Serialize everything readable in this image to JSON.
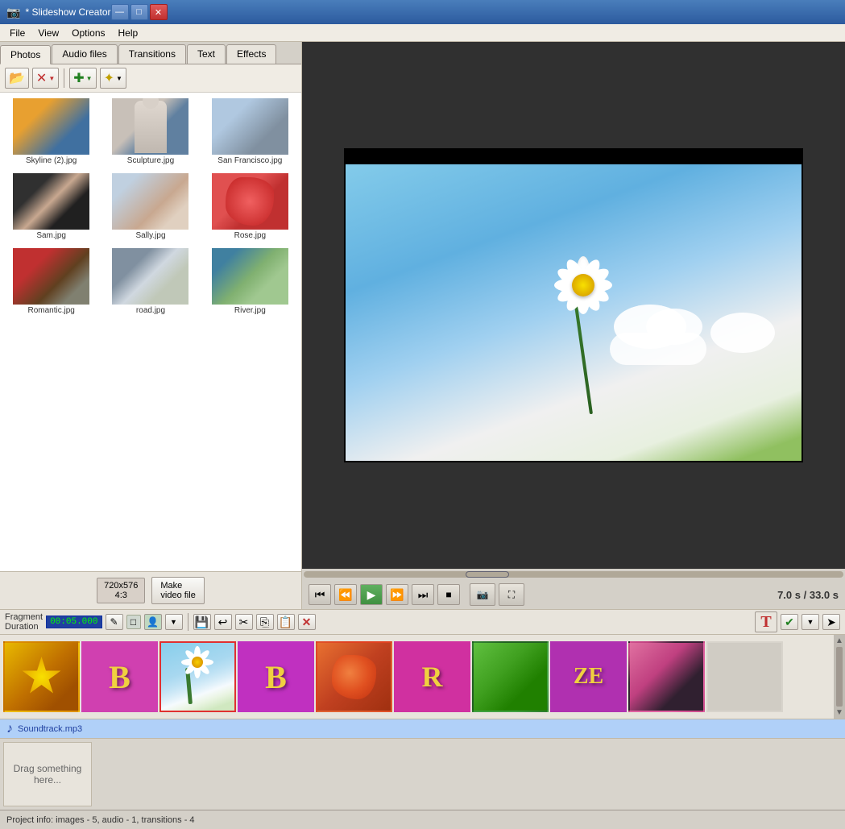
{
  "app": {
    "title": "Slideshow Creator",
    "icon": "📷"
  },
  "titlebar": {
    "title": "* Slideshow Creator",
    "minimize": "—",
    "maximize": "□",
    "close": "✕"
  },
  "menubar": {
    "items": [
      "File",
      "View",
      "Options",
      "Help"
    ]
  },
  "tabs": {
    "items": [
      "Photos",
      "Audio files",
      "Transitions",
      "Text",
      "Effects"
    ],
    "active": "Photos"
  },
  "toolbar": {
    "open_label": "Open",
    "delete_label": "Delete",
    "add_label": "Add",
    "star_label": "★"
  },
  "thumbnails": [
    {
      "id": "skyline2",
      "label": "Skyline (2).jpg",
      "class": "thumb-skyline2"
    },
    {
      "id": "sculpture",
      "label": "Sculpture.jpg",
      "class": "thumb-sculpture"
    },
    {
      "id": "sanfrancisco",
      "label": "San Francisco.jpg",
      "class": "thumb-sanfran"
    },
    {
      "id": "sam",
      "label": "Sam.jpg",
      "class": "thumb-sam"
    },
    {
      "id": "sally",
      "label": "Sally.jpg",
      "class": "thumb-sally"
    },
    {
      "id": "rose",
      "label": "Rose.jpg",
      "class": "thumb-rose"
    },
    {
      "id": "romantic",
      "label": "Romantic.jpg",
      "class": "thumb-romantic"
    },
    {
      "id": "road",
      "label": "road.jpg",
      "class": "thumb-road"
    },
    {
      "id": "river",
      "label": "River.jpg",
      "class": "thumb-river"
    }
  ],
  "resolution": {
    "label": "720x576\n4:3"
  },
  "make_video_btn": "Make\nvideo file",
  "player": {
    "time_current": "7.0 s",
    "time_total": "33.0 s",
    "time_separator": " / "
  },
  "fragment": {
    "label": "Fragment\nDuration",
    "time": "00:05.000"
  },
  "timeline": {
    "items": [
      {
        "id": "tl-yellow",
        "class": "tl-thumb-yellow",
        "type": "photo"
      },
      {
        "id": "tl-b1",
        "class": "tl-thumb-b1",
        "type": "text",
        "letter": "B"
      },
      {
        "id": "tl-daisy",
        "class": "tl-thumb-daisy",
        "type": "photo",
        "selected": true
      },
      {
        "id": "tl-b2",
        "class": "tl-thumb-b2",
        "type": "text",
        "letter": "B"
      },
      {
        "id": "tl-rose",
        "class": "tl-thumb-rose",
        "type": "photo"
      },
      {
        "id": "tl-r1",
        "class": "tl-thumb-r1",
        "type": "text",
        "letter": "R"
      },
      {
        "id": "tl-green",
        "class": "tl-thumb-green",
        "type": "photo"
      },
      {
        "id": "tl-ze",
        "class": "tl-thumb-ze",
        "type": "text",
        "letter": "ZE"
      },
      {
        "id": "tl-bee",
        "class": "tl-thumb-bee",
        "type": "photo"
      },
      {
        "id": "tl-empty",
        "class": "tl-thumb-empty",
        "type": "empty"
      }
    ]
  },
  "audio": {
    "filename": "Soundtrack.mp3"
  },
  "drag_area": {
    "text": "Drag\nsomething here..."
  },
  "statusbar": {
    "text": "Project info: images - 5, audio - 1, transitions - 4"
  }
}
